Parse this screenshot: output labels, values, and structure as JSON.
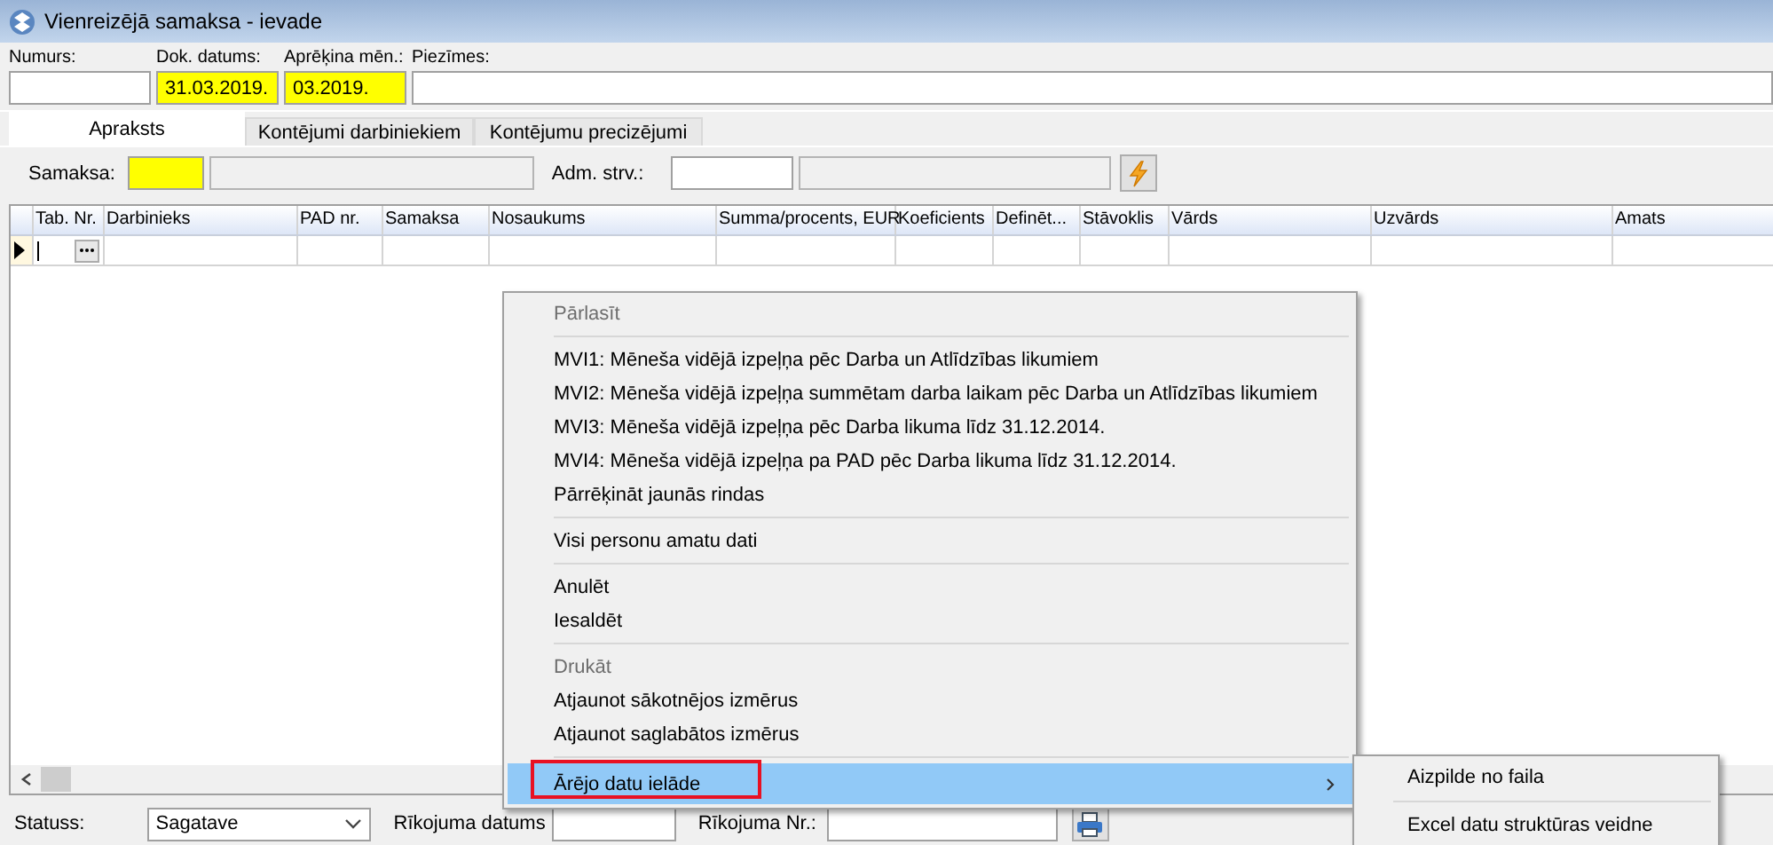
{
  "window": {
    "title": "Vienreizējā samaksa - ievade"
  },
  "header_fields": [
    {
      "label": "Numurs:",
      "required": false
    },
    {
      "label": "Dok. datums:",
      "value": "31.03.2019.",
      "required": true
    },
    {
      "label": "Aprēķina mēn.:",
      "value": "03.2019.",
      "required": true
    },
    {
      "label": "Piezīmes:",
      "required": false
    }
  ],
  "tabs": [
    {
      "label": "Apraksts",
      "selected": true
    },
    {
      "label": "Kontējumi darbiniekiem",
      "selected": false
    },
    {
      "label": "Kontējumu precizējumi",
      "selected": false
    }
  ],
  "filter_bar": {
    "payment_label": "Samaksa:",
    "payment_required": true,
    "unit_label": "Adm. strv.:"
  },
  "grid": {
    "columns": [
      "Tab. Nr.",
      "Darbinieks",
      "PAD nr.",
      "Samaksa",
      "Nosaukums",
      "Summa/procents, EUR",
      "Koeficients",
      "Definēt...",
      "Stāvoklis",
      "Vārds",
      "Uzvārds",
      "Amats"
    ]
  },
  "context_menu": {
    "items": [
      {
        "kind": "item",
        "label": "Pārlasīt",
        "disabled": true,
        "selected": false,
        "annotated": false
      },
      {
        "kind": "separator"
      },
      {
        "kind": "item",
        "label": "MVI1: Mēneša vidējā izpeļņa pēc Darba un Atlīdzības likumiem",
        "disabled": false,
        "selected": false,
        "annotated": false
      },
      {
        "kind": "item",
        "label": "MVI2: Mēneša vidējā izpeļņa summētam darba laikam pēc Darba un Atlīdzības likumiem",
        "disabled": false,
        "selected": false,
        "annotated": false
      },
      {
        "kind": "item",
        "label": "MVI3: Mēneša vidējā izpeļņa pēc Darba likuma līdz 31.12.2014.",
        "disabled": false,
        "selected": false,
        "annotated": false
      },
      {
        "kind": "item",
        "label": "MVI4: Mēneša vidējā izpeļņa pa PAD pēc Darba likuma līdz 31.12.2014.",
        "disabled": false,
        "selected": false,
        "annotated": false
      },
      {
        "kind": "item",
        "label": "Pārrēķināt jaunās rindas",
        "disabled": false,
        "selected": false,
        "annotated": false
      },
      {
        "kind": "separator"
      },
      {
        "kind": "item",
        "label": "Visi personu amatu dati",
        "disabled": false,
        "selected": false,
        "annotated": false
      },
      {
        "kind": "separator"
      },
      {
        "kind": "item",
        "label": "Anulēt",
        "disabled": false,
        "selected": false,
        "annotated": false
      },
      {
        "kind": "item",
        "label": "Iesaldēt",
        "disabled": false,
        "selected": false,
        "annotated": false
      },
      {
        "kind": "separator"
      },
      {
        "kind": "item",
        "label": "Drukāt",
        "disabled": true,
        "selected": false,
        "annotated": false
      },
      {
        "kind": "item",
        "label": "Atjaunot sākotnējos izmērus",
        "disabled": false,
        "selected": false,
        "annotated": false
      },
      {
        "kind": "item",
        "label": "Atjaunot saglabātos izmērus",
        "disabled": false,
        "selected": false,
        "annotated": false
      },
      {
        "kind": "separator"
      },
      {
        "kind": "submenu",
        "label": "Ārējo datu ielāde",
        "disabled": false,
        "selected": true,
        "annotated": true
      }
    ]
  },
  "submenu": {
    "items": [
      {
        "kind": "item",
        "label": "Aizpilde no faila"
      },
      {
        "kind": "separator"
      },
      {
        "kind": "item",
        "label": "Excel datu struktūras veidne"
      }
    ]
  },
  "status_bar": {
    "status_label": "Statuss:",
    "status_value": "Sagatave",
    "order_date_label": "Rīkojuma datums",
    "order_no_label": "Rīkojuma Nr.:"
  }
}
